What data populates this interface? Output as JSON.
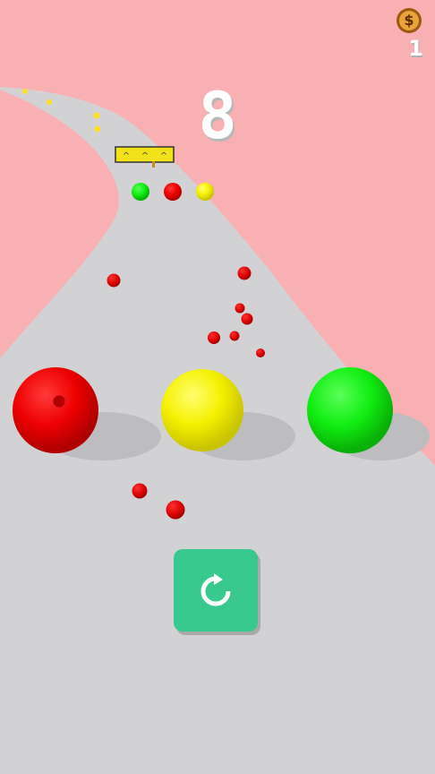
{
  "hud": {
    "coin_icon": "dollar-coin-icon",
    "coin_symbol": "$",
    "coin_count": "1",
    "level": "8"
  },
  "gate": {
    "markers": [
      "^",
      "^",
      "^"
    ]
  },
  "balls": {
    "player_balls": [
      {
        "color": "#f00000",
        "name": "red"
      },
      {
        "color": "#f2f200",
        "name": "yellow"
      },
      {
        "color": "#10ef10",
        "name": "green"
      }
    ],
    "target_balls": [
      {
        "color": "#10dd10",
        "name": "green"
      },
      {
        "color": "#e00000",
        "name": "red"
      },
      {
        "color": "#f0e010",
        "name": "yellow"
      }
    ]
  },
  "colors": {
    "background": "#f9b0b2",
    "track": "#d2d2d4",
    "restart_button": "#37c98e"
  },
  "controls": {
    "restart_icon": "restart-arrow-icon"
  }
}
